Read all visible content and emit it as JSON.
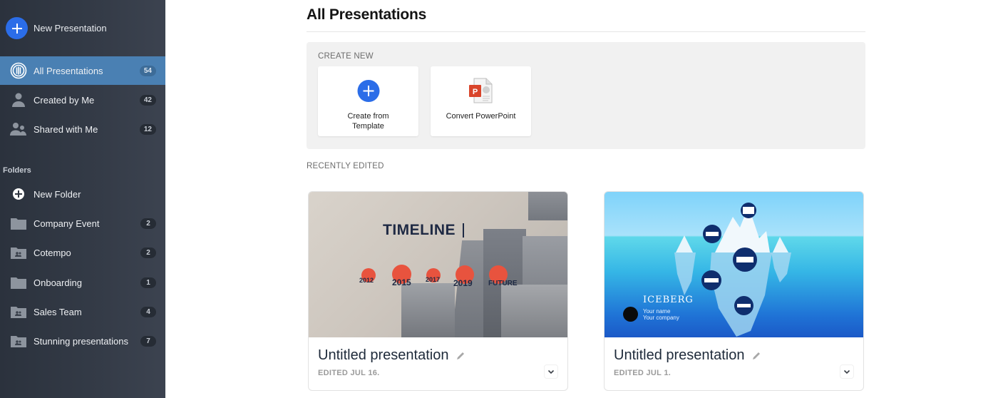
{
  "sidebar": {
    "new_presentation": "New Presentation",
    "nav": [
      {
        "label": "All Presentations",
        "count": "54",
        "icon": "all-presentations-icon",
        "active": true
      },
      {
        "label": "Created by Me",
        "count": "42",
        "icon": "person-icon",
        "active": false
      },
      {
        "label": "Shared with Me",
        "count": "12",
        "icon": "people-icon",
        "active": false
      }
    ],
    "folders_heading": "Folders",
    "new_folder": "New Folder",
    "folders": [
      {
        "label": "Company Event",
        "count": "2",
        "icon": "folder-icon"
      },
      {
        "label": "Cotempo",
        "count": "2",
        "icon": "shared-folder-icon"
      },
      {
        "label": "Onboarding",
        "count": "1",
        "icon": "folder-icon"
      },
      {
        "label": "Sales Team",
        "count": "4",
        "icon": "shared-folder-icon"
      },
      {
        "label": "Stunning presentations",
        "count": "7",
        "icon": "shared-folder-icon"
      }
    ]
  },
  "main": {
    "title": "All Presentations",
    "create_new": {
      "label": "CREATE NEW",
      "cards": [
        {
          "label": "Create from Template",
          "icon": "plus-circle-icon"
        },
        {
          "label": "Convert PowerPoint",
          "icon": "powerpoint-file-icon"
        }
      ]
    },
    "recently_edited": {
      "label": "RECENTLY EDITED",
      "presentations": [
        {
          "title": "Untitled presentation",
          "edited": "EDITED JUL 16.",
          "thumbnail": {
            "heading": "TIMELINE",
            "milestones": [
              "2012",
              "2015",
              "2017",
              "2019",
              "FUTURE"
            ]
          }
        },
        {
          "title": "Untitled presentation",
          "edited": "EDITED JUL 1.",
          "thumbnail": {
            "heading": "ICEBERG",
            "name": "Your name",
            "company": "Your company"
          }
        }
      ]
    }
  },
  "colors": {
    "accent_blue": "#2b6de8",
    "sidebar_active": "#4a80b3",
    "timeline_dot": "#e8533e",
    "powerpoint_red": "#d9452b"
  }
}
